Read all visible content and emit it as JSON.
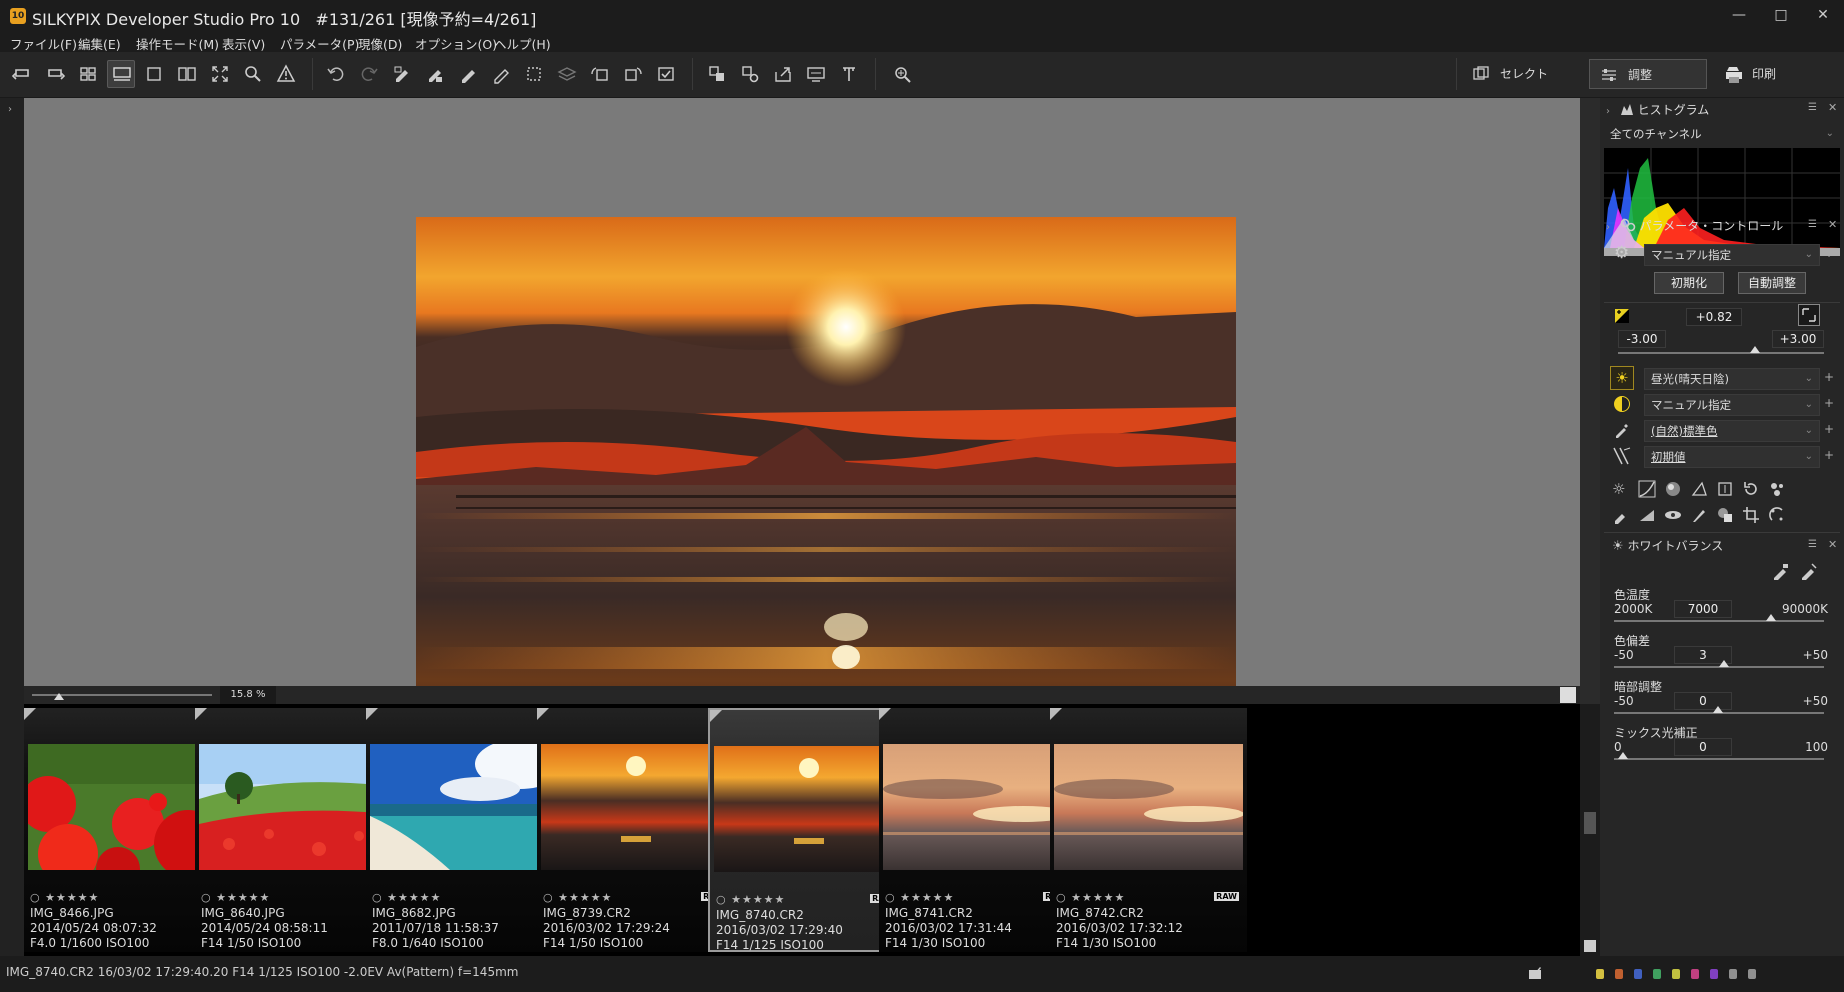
{
  "window": {
    "title": "SILKYPIX Developer Studio Pro 10   #131/261 [現像予約=4/261]",
    "logo_text": "10",
    "minimize": "—",
    "maximize": "□",
    "close": "✕"
  },
  "menu": [
    "ファイル(F)",
    "編集(E)",
    "操作モード(M)",
    "表示(V)",
    "パラメータ(P)",
    "現像(D)",
    "オプション(O)",
    "ヘルプ(H)"
  ],
  "modes": {
    "select": "セレクト",
    "adjust": "調整",
    "print": "印刷",
    "active": "adjust"
  },
  "zoom": {
    "value": "15.8",
    "unit": "%"
  },
  "thumbnails": [
    {
      "filename": "IMG_8466.JPG",
      "date": "2014/05/24 08:07:32",
      "exif": "F4.0 1/1600 ISO100",
      "raw": false,
      "selected": false,
      "scene": "poppy-closeup",
      "rating": "○ ★★★★★"
    },
    {
      "filename": "IMG_8640.JPG",
      "date": "2014/05/24 08:58:11",
      "exif": "F14 1/50 ISO100",
      "raw": false,
      "selected": false,
      "scene": "poppy-field",
      "rating": "○ ★★★★★"
    },
    {
      "filename": "IMG_8682.JPG",
      "date": "2011/07/18 11:58:37",
      "exif": "F8.0 1/640 ISO100",
      "raw": false,
      "selected": false,
      "scene": "beach",
      "rating": "○ ★★★★★"
    },
    {
      "filename": "IMG_8739.CR2",
      "date": "2016/03/02 17:29:24",
      "exif": "F14 1/50 ISO100",
      "raw": true,
      "selected": false,
      "scene": "sunset",
      "rating": "○ ★★★★★"
    },
    {
      "filename": "IMG_8740.CR2",
      "date": "2016/03/02 17:29:40",
      "exif": "F14 1/125 ISO100",
      "raw": true,
      "selected": true,
      "scene": "sunset",
      "rating": "○ ★★★★★"
    },
    {
      "filename": "IMG_8741.CR2",
      "date": "2016/03/02 17:31:44",
      "exif": "F14 1/30 ISO100",
      "raw": true,
      "selected": false,
      "scene": "sunset-cloudy",
      "rating": "○ ★★★★★"
    },
    {
      "filename": "IMG_8742.CR2",
      "date": "2016/03/02 17:32:12",
      "exif": "F14 1/30 ISO100",
      "raw": true,
      "selected": false,
      "scene": "sunset-cloudy",
      "rating": "○ ★★★★★"
    }
  ],
  "raw_badge": "RAW",
  "histogram": {
    "title": "ヒストグラム",
    "channel": "全てのチャンネル"
  },
  "param_control": {
    "title": "パラメータ・コントロール",
    "preset": "マニュアル指定",
    "init_button": "初期化",
    "auto_button": "自動調整",
    "exposure": {
      "value": "+0.82",
      "min": "-3.00",
      "max": "+3.00"
    },
    "wb_preset": "昼光(晴天日陰)",
    "tone_preset": "マニュアル指定",
    "color_preset": "(自然)標準色",
    "sharp_preset": "初期値"
  },
  "white_balance": {
    "title": "ホワイトバランス",
    "sliders": [
      {
        "label": "色温度",
        "min": "2000K",
        "max": "90000K",
        "value": "7000",
        "pos": 0.78
      },
      {
        "label": "色偏差",
        "min": "-50",
        "max": "+50",
        "value": "3",
        "pos": 0.53
      },
      {
        "label": "暗部調整",
        "min": "-50",
        "max": "+50",
        "value": "0",
        "pos": 0.5
      },
      {
        "label": "ミックス光補正",
        "min": "0",
        "max": "100",
        "value": "0",
        "pos": 0.0
      }
    ]
  },
  "status": "IMG_8740.CR2 16/03/02 17:29:40.20 F14 1/125 ISO100 -2.0EV Av(Pattern) f=145mm",
  "status_colors": [
    "#d4c040",
    "#c06030",
    "#4060c0",
    "#40a060",
    "#c0c040",
    "#c04080",
    "#8040c0",
    "#909090",
    "#909090"
  ]
}
